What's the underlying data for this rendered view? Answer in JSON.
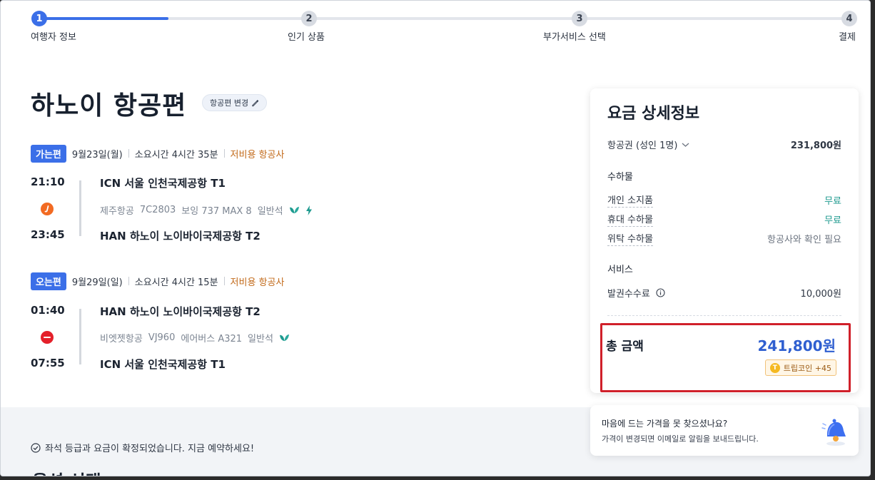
{
  "stepper": {
    "steps": [
      {
        "num": "1",
        "label": "여행자 정보"
      },
      {
        "num": "2",
        "label": "인기 상품"
      },
      {
        "num": "3",
        "label": "부가서비스 선택"
      },
      {
        "num": "4",
        "label": "결제"
      }
    ],
    "progress_percent": 16
  },
  "page_title": "하노이 항공편",
  "change_flight_label": "항공편 변경",
  "outbound": {
    "badge": "가는편",
    "date": "9월23일(월)",
    "duration": "소요시간 4시간 35분",
    "tag": "저비용 항공사",
    "depart_time": "21:10",
    "arrive_time": "23:45",
    "depart_airport": "ICN 서울 인천국제공항 T1",
    "arrive_airport": "HAN 하노이 노이바이국제공항 T2",
    "airline": "제주항공",
    "flight_no": "7C2803",
    "aircraft": "보잉 737 MAX 8",
    "cabin": "일반석",
    "icons": [
      "leaf-icon",
      "power-icon"
    ]
  },
  "inbound": {
    "badge": "오는편",
    "date": "9월29일(일)",
    "duration": "소요시간 4시간 15분",
    "tag": "저비용 항공사",
    "depart_time": "01:40",
    "arrive_time": "07:55",
    "depart_airport": "HAN 하노이 노이바이국제공항 T2",
    "arrive_airport": "ICN 서울 인천국제공항 T1",
    "airline": "비엣젯항공",
    "flight_no": "VJ960",
    "aircraft": "에어버스 A321",
    "cabin": "일반석",
    "icons": [
      "leaf-icon"
    ]
  },
  "fare": {
    "title": "요금 상세정보",
    "ticket_label": "항공권 (성인 1명)",
    "ticket_value": "231,800원",
    "baggage_header": "수하물",
    "baggage": [
      {
        "label": "개인 소지품",
        "value": "무료"
      },
      {
        "label": "휴대 수하물",
        "value": "무료"
      },
      {
        "label": "위탁 수하물",
        "value": "항공사와 확인 필요"
      }
    ],
    "service_header": "서비스",
    "service_label": "발권수수료",
    "service_value": "10,000원",
    "total_label": "총 금액",
    "total_value": "241,800원",
    "coin_label": "트립코인 +45",
    "coin_glyph": "T"
  },
  "confirm_text": "좌석 등급과 요금이 확정되었습니다. 지금 예약하세요!",
  "next_section_title": "옵션 선택",
  "price_alert": {
    "title": "마음에 드는 가격을 못 찾으셨나요?",
    "body": "가격이 변경되면 이메일로 알림을 보내드립니다."
  },
  "colors": {
    "accent": "#3b6fe8",
    "lowcost": "#c26a1a",
    "free": "#1f9a8f",
    "total": "#2f5fd0",
    "highlight_border": "#d0202a"
  }
}
